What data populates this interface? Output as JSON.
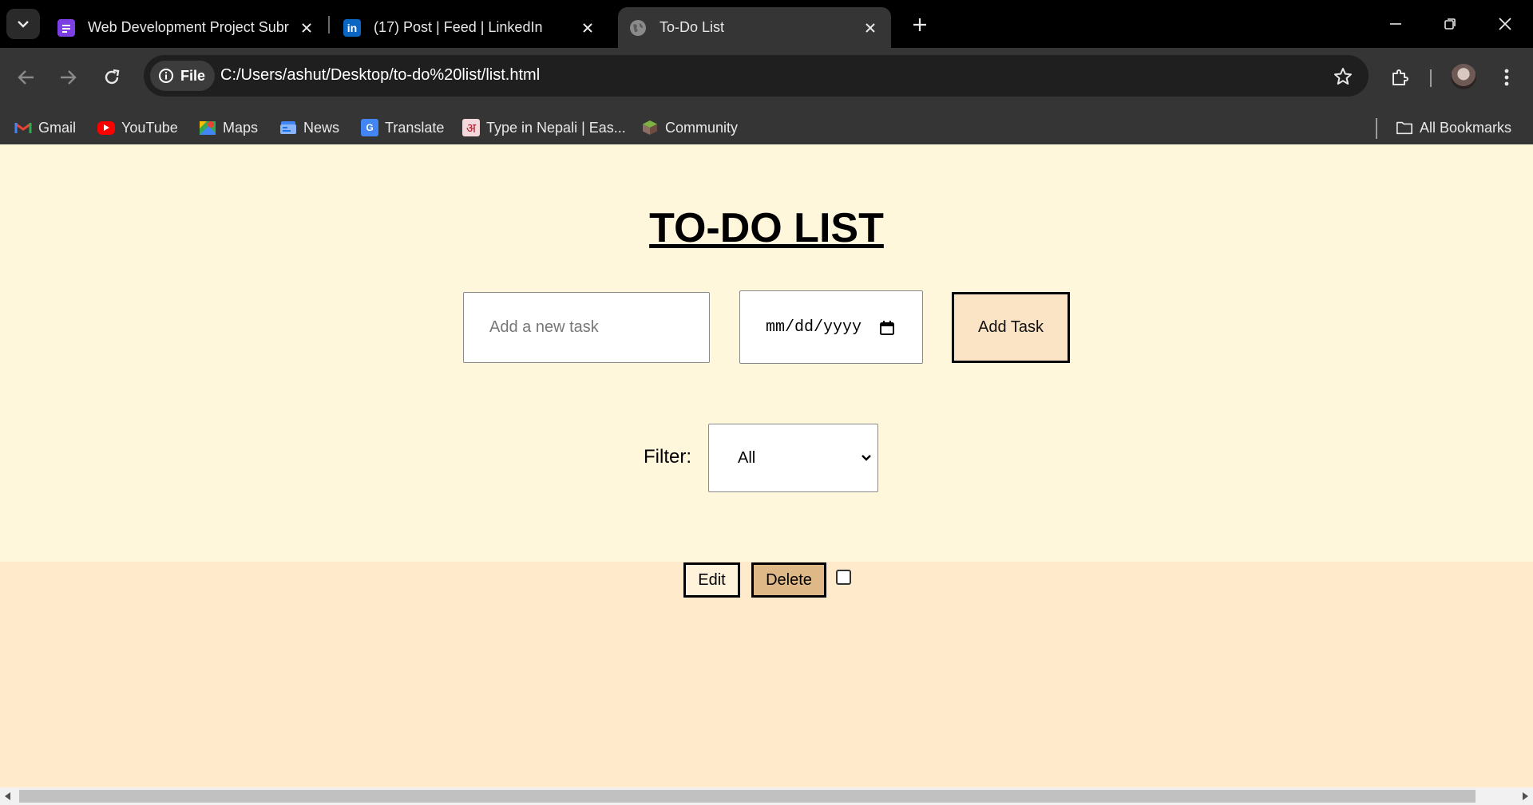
{
  "browser": {
    "tabs": [
      {
        "title": "Web Development Project Subr",
        "icon": "form-icon",
        "color": "#7B3FE4",
        "active": false
      },
      {
        "title": "(17) Post | Feed | LinkedIn",
        "icon": "linkedin-icon",
        "color": "#0A66C2",
        "active": false
      },
      {
        "title": "To-Do List",
        "icon": "globe-icon",
        "active": true
      }
    ],
    "omnibox": {
      "chip_label": "File",
      "url": "C:/Users/ashut/Desktop/to-do%20list/list.html"
    },
    "bookmarks": [
      {
        "label": "Gmail",
        "icon": "gmail-icon"
      },
      {
        "label": "YouTube",
        "icon": "youtube-icon"
      },
      {
        "label": "Maps",
        "icon": "maps-icon"
      },
      {
        "label": "News",
        "icon": "news-icon"
      },
      {
        "label": "Translate",
        "icon": "translate-icon"
      },
      {
        "label": "Type in Nepali | Eas...",
        "icon": "nepali-icon",
        "glyph": "अ"
      },
      {
        "label": "Community",
        "icon": "community-icon"
      }
    ],
    "all_bookmarks_label": "All Bookmarks"
  },
  "page": {
    "title": "TO-DO LIST",
    "task_input": {
      "placeholder": "Add a new task",
      "value": ""
    },
    "date_input": {
      "value": "mm/dd/yyyy"
    },
    "add_button": "Add Task",
    "filter": {
      "label": "Filter:",
      "selected": "All"
    },
    "task": {
      "edit_label": "Edit",
      "delete_label": "Delete",
      "completed": false
    }
  },
  "colors": {
    "page_bg": "#FFF7DC",
    "task_area_bg": "#FFEBCB",
    "add_button_bg": "#FBE4C6",
    "delete_button_bg": "#DEB887"
  }
}
